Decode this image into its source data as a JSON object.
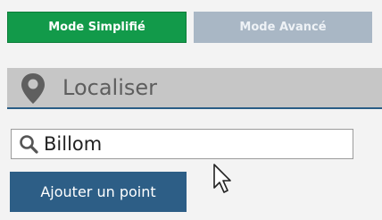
{
  "mode_bar": {
    "simple_label": "Mode Simplifié",
    "advanced_label": "Mode Avancé",
    "active_mode": "simple"
  },
  "locate_section": {
    "title": "Localiser",
    "icon": "map-pin-icon"
  },
  "search": {
    "value": "Billom",
    "icon": "search-icon"
  },
  "actions": {
    "add_point_label": "Ajouter un point"
  },
  "colors": {
    "simple_mode_bg": "#129a4a",
    "advanced_mode_bg": "#a9b7c5",
    "header_bg": "#c6c6c6",
    "accent_blue": "#2d5e86",
    "background": "#f3f3f3"
  }
}
